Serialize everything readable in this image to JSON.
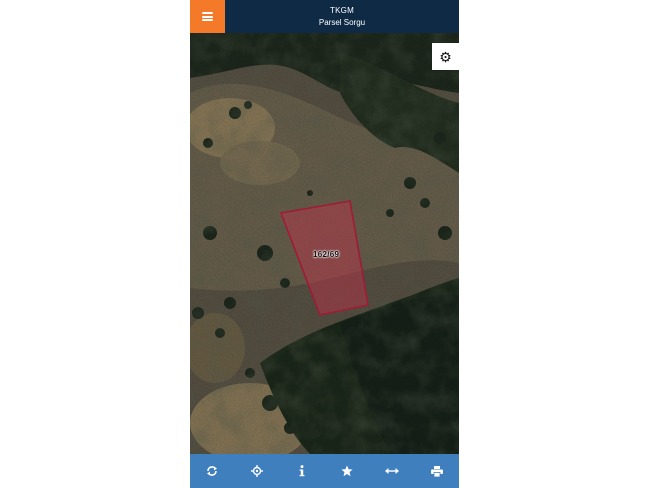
{
  "header": {
    "title": "TKGM",
    "subtitle": "Parsel Sorgu",
    "menu_icon": "hamburger-icon",
    "accent_color": "#f47a2a",
    "bar_color": "#0e2a45"
  },
  "map": {
    "type": "satellite",
    "parcel": {
      "label": "162/69",
      "stroke_color": "#a01b35",
      "fill_color": "#c0304a"
    },
    "settings_icon": "gear-icon"
  },
  "toolbar": {
    "bar_color": "#3f7fbe",
    "items": [
      {
        "icon": "refresh-icon"
      },
      {
        "icon": "locate-icon"
      },
      {
        "icon": "info-icon"
      },
      {
        "icon": "star-icon"
      },
      {
        "icon": "measure-icon"
      },
      {
        "icon": "print-icon"
      }
    ]
  }
}
